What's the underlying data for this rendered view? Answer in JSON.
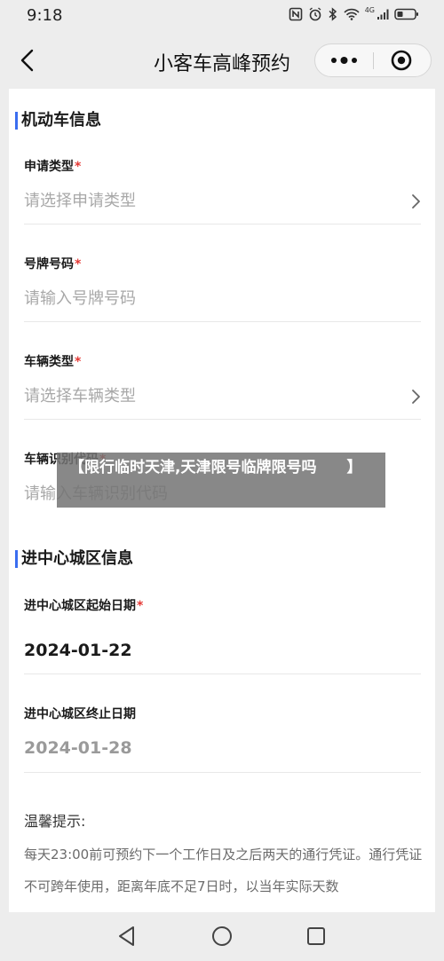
{
  "status_bar": {
    "time": "9:18",
    "network_label": "4G",
    "icons": [
      "nfc-icon",
      "alarm-icon",
      "bluetooth-icon",
      "wifi-icon",
      "signal-icon",
      "battery-icon"
    ]
  },
  "nav": {
    "title": "小客车高峰预约",
    "icons": [
      "back-arrow-icon",
      "more-dots-icon",
      "target-icon"
    ]
  },
  "vehicle_section": {
    "title": "机动车信息",
    "accent_color": "#3a6df0",
    "fields": [
      {
        "label": "申请类型",
        "required_mark": "*",
        "placeholder": "请选择申请类型",
        "icon": "chevron-right-icon"
      },
      {
        "label": "号牌号码",
        "required_mark": "*",
        "placeholder": "请输入号牌号码"
      },
      {
        "label": "车辆类型",
        "required_mark": "*",
        "placeholder": "请选择车辆类型",
        "icon": "chevron-right-icon"
      },
      {
        "label": "车辆识别代码",
        "required_mark": "*",
        "placeholder": "请输入车辆识别代码"
      }
    ]
  },
  "city_section": {
    "title": "进中心城区信息",
    "start_label": "进中心城区起始日期",
    "start_required_mark": "*",
    "start_value": "2024-01-22",
    "end_label": "进中心城区终止日期",
    "end_value": "2024-01-28"
  },
  "tips": {
    "title": "温馨提示:",
    "text": "每天23:00前可预约下一个工作日及之后两天的通行凭证。通行凭证不可跨年使用，距离年底不足7日时，以当年实际天数"
  },
  "overlay": {
    "text": "【限行临时天津,天津限号临牌限号吗　　】"
  },
  "colors": {
    "required": "#e53935",
    "placeholder": "#a8a8a8",
    "background": "#ededed"
  }
}
